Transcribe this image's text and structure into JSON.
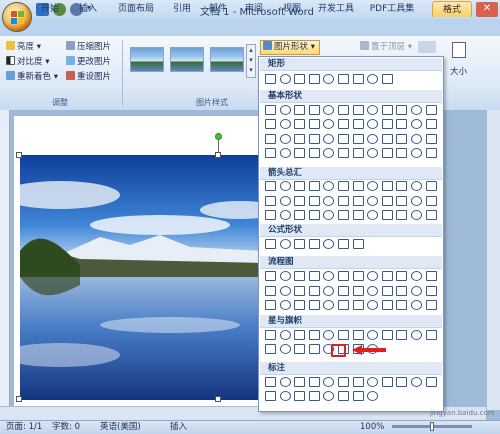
{
  "titlebar": {
    "title": "文档 1 - Microsoft Word"
  },
  "tabs": [
    "开始",
    "插入",
    "页面布局",
    "引用",
    "邮件",
    "审阅",
    "视图",
    "开发工具",
    "PDF工具集",
    "格式"
  ],
  "ribbon": {
    "adjust": {
      "brightness": "亮度",
      "contrast": "对比度",
      "recolor": "重新着色",
      "compress": "压缩图片",
      "change": "更改图片",
      "reset": "重设图片",
      "label": "调整"
    },
    "styles": {
      "label": "图片样式"
    },
    "shape_btn": "图片形状",
    "arrange": {
      "bring_front": "置于顶层",
      "size": "大小"
    }
  },
  "gallery": {
    "categories": [
      "矩形",
      "基本形状",
      "箭头总汇",
      "公式形状",
      "流程图",
      "星与旗帜",
      "标注"
    ]
  },
  "statusbar": {
    "page": "页面: 1/1",
    "words": "字数: 0",
    "lang": "英语(美国)",
    "mode": "插入",
    "zoom": "100%"
  },
  "watermark": "jingyan.baidu.com",
  "colors": {
    "accent": "#f8cf6a",
    "selected": "#e02020",
    "ribbon": "#dce8f6"
  }
}
